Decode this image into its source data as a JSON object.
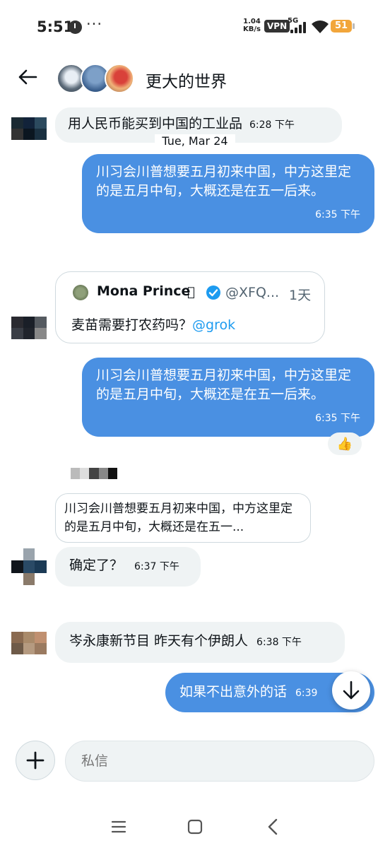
{
  "status_bar": {
    "time": "5:51",
    "dots": "···",
    "net_speed_value": "1.04",
    "net_speed_unit": "KB/s",
    "vpn": "VPN",
    "network": "5G",
    "battery": "51"
  },
  "header": {
    "title": "更大的世界",
    "back_icon": "arrow-left-icon"
  },
  "messages": {
    "m1": {
      "text": "用人民币能买到中国的工业品",
      "time": "6:28 下午"
    },
    "date_separator": "Tue, Mar 24",
    "m2": {
      "text": "川习会川普想要五月初来中国，中方这里定的是五月中旬，大概还是在五一后来。",
      "time": "6:35 下午"
    },
    "quote": {
      "author": "Mona Prince",
      "handle": "@XFQ...",
      "age": "1天",
      "text_prefix": "麦苗需要打农药吗？",
      "mention": "@grok"
    },
    "m3": {
      "text": "川习会川普想要五月初来中国，中方这里定的是五月中旬，大概还是在五一后来。",
      "time": "6:35 下午",
      "reaction": "👍"
    },
    "reply_quote": {
      "text": "川习会川普想要五月初来中国，中方这里定的是五月中旬，大概还是在五一..."
    },
    "m4": {
      "text": "确定了？",
      "time": "6:37 下午"
    },
    "m5": {
      "text": "岑永康新节目 昨天有个伊朗人",
      "time": "6:38 下午"
    },
    "m6": {
      "text": "如果不出意外的话",
      "time": "6:39"
    }
  },
  "composer": {
    "placeholder": "私信"
  },
  "colors": {
    "outgoing_bubble": "#4a90e2",
    "incoming_bubble": "#eff3f4",
    "mention": "#1d9bf0",
    "verified": "#1d9bf0"
  }
}
